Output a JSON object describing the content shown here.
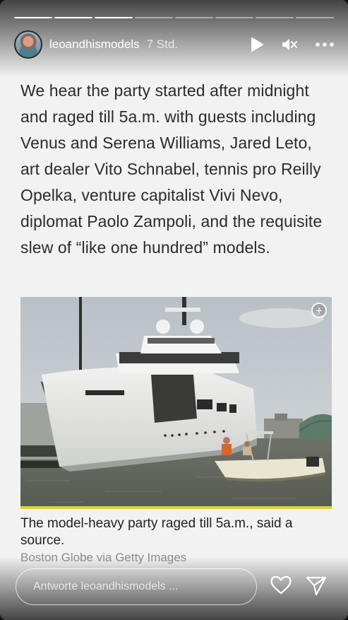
{
  "story": {
    "segments_total": 8,
    "segments_done": 3
  },
  "header": {
    "username": "leoandhismodels",
    "time": "7 Std.",
    "icons": [
      "play-icon",
      "mute-icon",
      "more-icon"
    ]
  },
  "article": {
    "text": "We hear the party started after midnight and raged till 5a.m. with guests including Venus and Serena Williams, Jared Leto, art dealer Vito Schnabel, tennis pro Reilly Opelka, venture capitalist Vivi Nevo, diplomat Paolo Zampoli, and the requisite slew of “like one hundred” models."
  },
  "photo": {
    "caption": "The model-heavy party raged till 5a.m., said a source.",
    "credit": "Boston Globe via Getty Images",
    "expand_icon": "plus-circle-icon"
  },
  "reply": {
    "placeholder": "Antworte leoandhismodels ..."
  },
  "colors": {
    "background": "#f2f2f2",
    "caption_bar": "#e3cf3b",
    "text": "#2b2b2b"
  }
}
